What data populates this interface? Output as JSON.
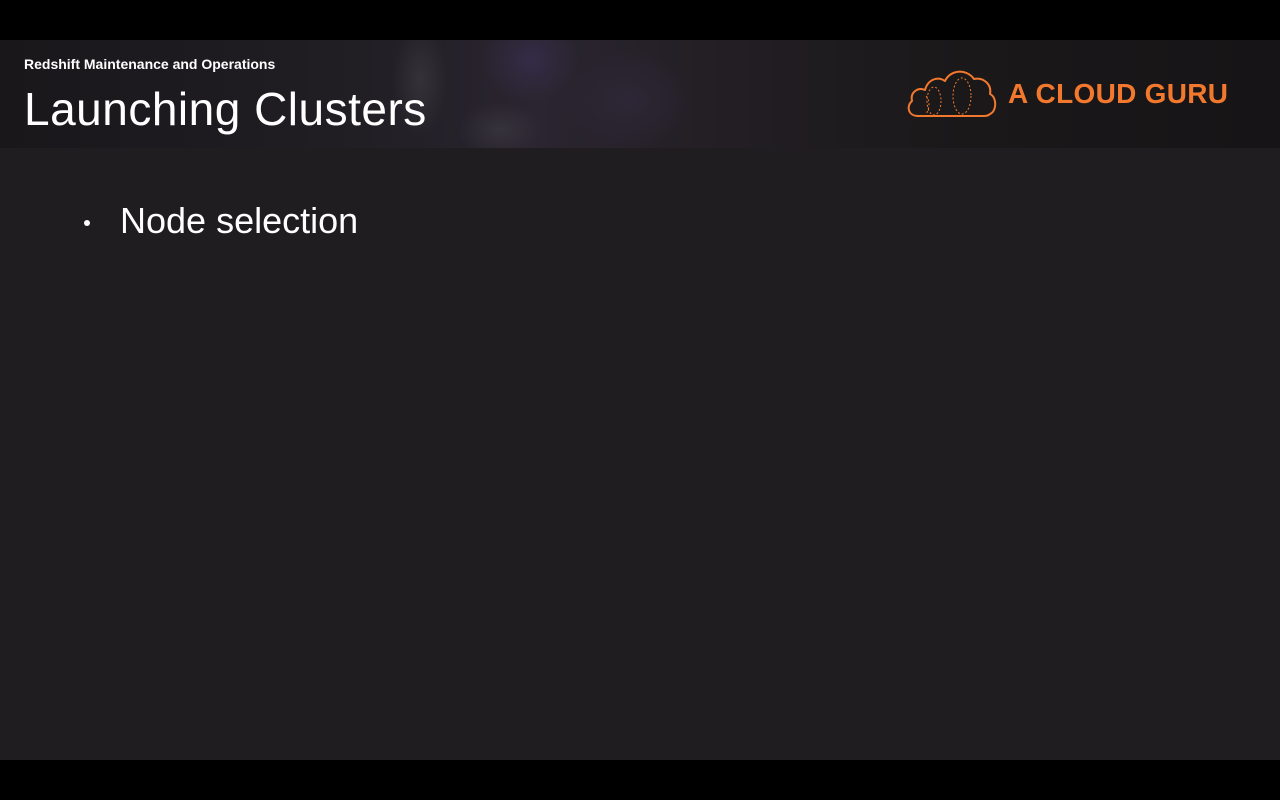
{
  "header": {
    "subtitle": "Redshift Maintenance and Operations",
    "title": "Launching Clusters"
  },
  "logo": {
    "text": "A CLOUD GURU",
    "icon": "cloud-icon",
    "color": "#f2782e"
  },
  "content": {
    "bullets": [
      {
        "text": "Node selection"
      }
    ]
  },
  "colors": {
    "background": "#1f1d20",
    "text": "#ffffff",
    "accent": "#f2782e"
  }
}
